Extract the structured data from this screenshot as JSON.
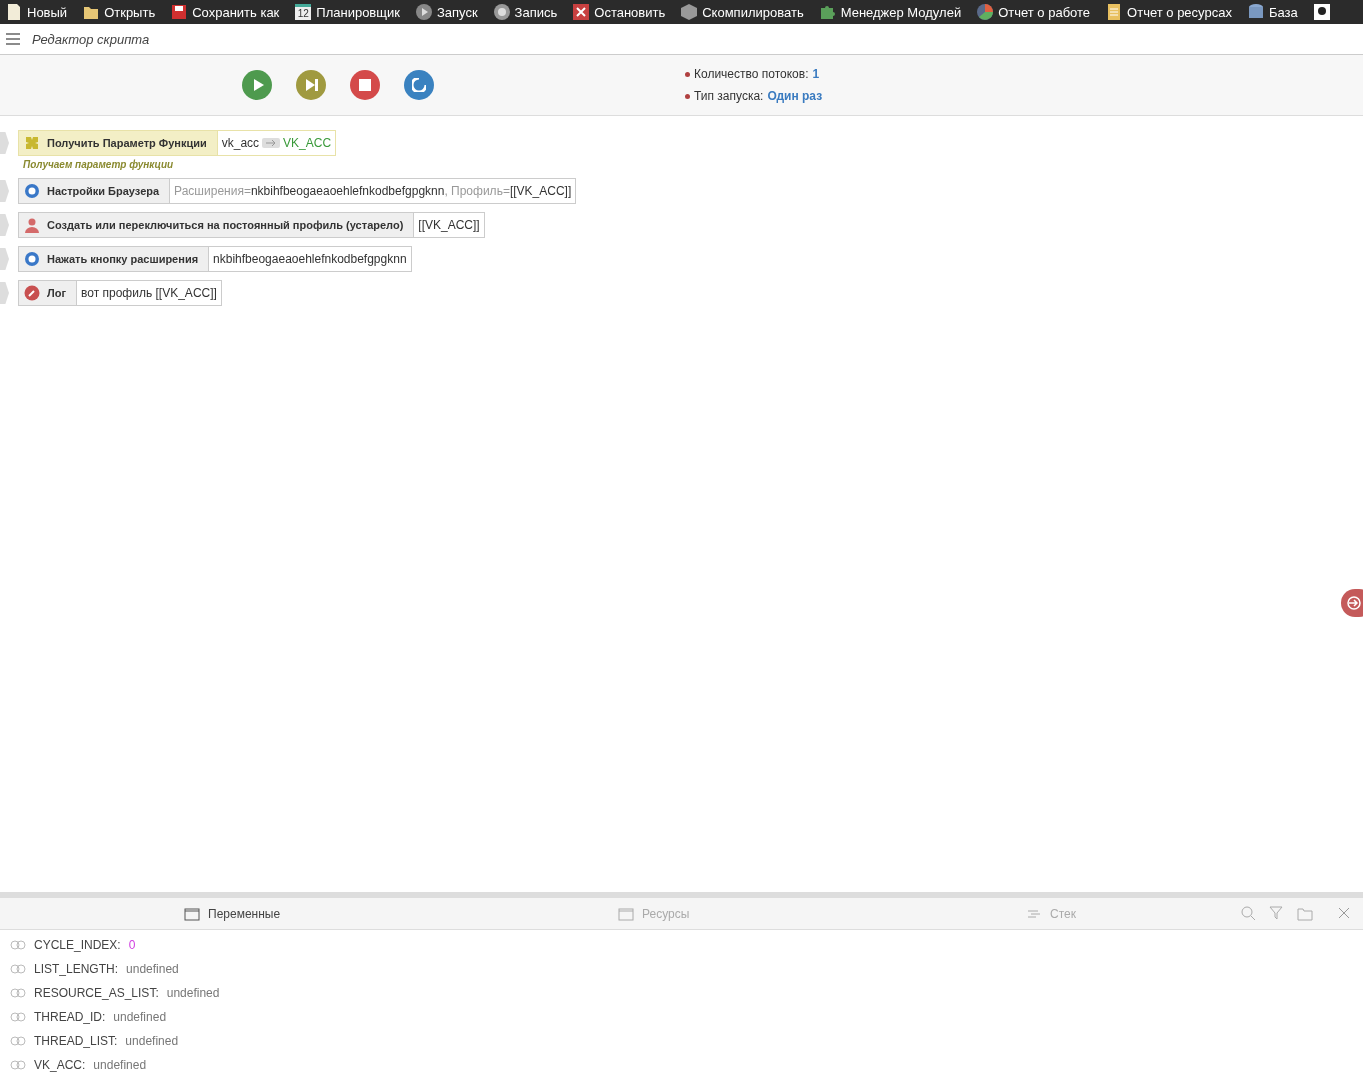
{
  "menu": [
    {
      "label": "Новый"
    },
    {
      "label": "Открыть"
    },
    {
      "label": "Сохранить как"
    },
    {
      "label": "Планировщик",
      "icon_text": "12"
    },
    {
      "label": "Запуск"
    },
    {
      "label": "Запись"
    },
    {
      "label": "Остановить"
    },
    {
      "label": "Скомпилировать"
    },
    {
      "label": "Менеджер Модулей"
    },
    {
      "label": "Отчет о работе"
    },
    {
      "label": "Отчет о ресурсах"
    },
    {
      "label": "База"
    }
  ],
  "header": {
    "title": "Редактор скрипта"
  },
  "info": [
    {
      "label": "Количество потоков:",
      "value": "1"
    },
    {
      "label": "Тип запуска:",
      "value": "Один раз"
    }
  ],
  "actions": [
    {
      "title": "Получить Параметр Функции",
      "kind": "function",
      "selected": true,
      "params": [
        {
          "kind": "value",
          "text": "vk_acc"
        },
        {
          "kind": "arrow"
        },
        {
          "kind": "output",
          "text": "VK_ACC"
        }
      ],
      "comment": "Получаем параметр функции"
    },
    {
      "title": "Настройки Браузера",
      "kind": "browser",
      "selected": false,
      "params": [
        {
          "kind": "label",
          "text": "Расширения="
        },
        {
          "kind": "value",
          "text": "nkbihfbeogaeaoehlefnkodbefgpgknn"
        },
        {
          "kind": "label",
          "text": ", Профиль="
        },
        {
          "kind": "value",
          "text": "[[VK_ACC]]"
        }
      ]
    },
    {
      "title": "Создать или переключиться на постоянный профиль (устарело)",
      "kind": "profile",
      "selected": false,
      "params": [
        {
          "kind": "value",
          "text": "[[VK_ACC]]"
        }
      ]
    },
    {
      "title": "Нажать кнопку расширения",
      "kind": "browser",
      "selected": false,
      "params": [
        {
          "kind": "value",
          "text": "nkbihfbeogaeaoehlefnkodbefgpgknn"
        }
      ]
    },
    {
      "title": "Лог",
      "kind": "log",
      "selected": false,
      "params": [
        {
          "kind": "value",
          "text": "вот профиль [[VK_ACC]]"
        }
      ]
    }
  ],
  "panel": {
    "tabs": [
      {
        "label": "Переменные",
        "selected": true
      },
      {
        "label": "Ресурсы",
        "selected": false
      },
      {
        "label": "Стек",
        "selected": false
      }
    ],
    "variables": [
      {
        "name": "CYCLE_INDEX:",
        "value": "0",
        "kind": "number"
      },
      {
        "name": "LIST_LENGTH:",
        "value": "undefined",
        "kind": "undefined"
      },
      {
        "name": "RESOURCE_AS_LIST:",
        "value": "undefined",
        "kind": "undefined"
      },
      {
        "name": "THREAD_ID:",
        "value": "undefined",
        "kind": "undefined"
      },
      {
        "name": "THREAD_LIST:",
        "value": "undefined",
        "kind": "undefined"
      },
      {
        "name": "VK_ACC:",
        "value": "undefined",
        "kind": "undefined"
      }
    ]
  }
}
